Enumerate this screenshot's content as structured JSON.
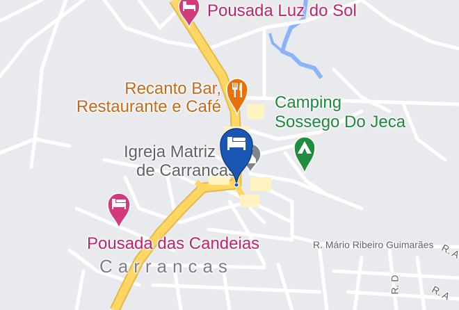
{
  "colors": {
    "background": "#e8eaed",
    "minor_road": "#ffffff",
    "main_road_fill": "#fdd663",
    "main_road_edge": "#e5b94b",
    "water": "#8ab4f8",
    "lodging": "#d33a7b",
    "food": "#e8710a",
    "park": "#1e8e3e",
    "church": "#80868b",
    "selected_marker": "#1a56b4"
  },
  "pois": {
    "pousada_luz": {
      "label": "Pousada Luz do Sol",
      "icon": "bed-icon"
    },
    "recanto": {
      "label_line1": "Recanto Bar,",
      "label_line2": "Restaurante e Café",
      "icon": "fork-knife-icon"
    },
    "camping": {
      "label_line1": "Camping",
      "label_line2": "Sossego Do Jeca",
      "icon": "tent-icon"
    },
    "igreja": {
      "label_line1": "Igreja Matriz",
      "label_line2": "de Carrancas",
      "icon": "church-icon"
    },
    "pousada_candeias": {
      "label": "Pousada das Candeias",
      "icon": "bed-icon"
    },
    "selected_marker": {
      "icon": "bed-icon"
    }
  },
  "area_label": "Carrancas",
  "roads": {
    "mario": "R. Mário Ribeiro Guimarães",
    "d": "R. D",
    "a1": "R. A",
    "a2": "R. A"
  }
}
